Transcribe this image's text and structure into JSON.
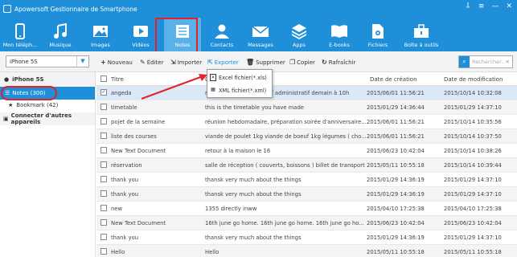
{
  "app": {
    "title": "Apowersoft Gestionnaire de Smartphone",
    "win_buttons": [
      "⇩",
      "≡",
      "—",
      "✕"
    ]
  },
  "toolbar": [
    {
      "label": "Mon téléph...",
      "icon": "phone-icon"
    },
    {
      "label": "Musique",
      "icon": "music-icon"
    },
    {
      "label": "Images",
      "icon": "image-icon"
    },
    {
      "label": "Vidéos",
      "icon": "video-icon"
    },
    {
      "label": "Notes",
      "icon": "notes-icon",
      "selected": true
    },
    {
      "label": "Contacts",
      "icon": "contacts-icon"
    },
    {
      "label": "Messages",
      "icon": "messages-icon"
    },
    {
      "label": "Apps",
      "icon": "apps-icon"
    },
    {
      "label": "E-books",
      "icon": "ebooks-icon"
    },
    {
      "label": "Fichiers",
      "icon": "files-icon"
    },
    {
      "label": "Boîte à outils",
      "icon": "toolbox-icon"
    }
  ],
  "device_select": "iPhone 5S",
  "ops": {
    "new": "Nouveau",
    "edit": "Éditer",
    "import": "Importer",
    "export": "Exporter",
    "delete": "Supprimer",
    "copy": "Copier",
    "refresh": "Rafraîchir"
  },
  "search": {
    "placeholder": "Rechercher..."
  },
  "sidebar": {
    "device": "iPhone 5S",
    "notes": "Notes (300)",
    "bookmark": "Bookmark (42)",
    "connect": "Connecter d'autres appareils"
  },
  "export_menu": {
    "excel": "Excel fichier(*.xls)",
    "xml": "XML fichier(*.xml)"
  },
  "table": {
    "headers": {
      "title": "Titre",
      "content": "C",
      "created": "Date de création",
      "modified": "Date de modification"
    },
    "rows": [
      {
        "title": "angeda",
        "content": "rendez-vous avec le chef administratif demain à 10h",
        "created": "2015/06/01 11:56:21",
        "modified": "2015/10/14 10:32:08",
        "checked": true
      },
      {
        "title": "timetable",
        "content": "this is the timetable you have made",
        "created": "2015/01/29 14:36:44",
        "modified": "2015/01/29 14:37:10"
      },
      {
        "title": "pojet de la semaine",
        "content": "réunion hebdomadaire, préparation soirée d'anniversaire...",
        "created": "2015/06/01 11:56:21",
        "modified": "2015/10/14 10:35:56"
      },
      {
        "title": "liste des courses",
        "content": "viande de poulet 1kg viande de boeuf 1kg légumes ( cho...",
        "created": "2015/06/01 11:56:21",
        "modified": "2015/10/14 10:37:50"
      },
      {
        "title": "New Text Document",
        "content": "retour à la maison le 16",
        "created": "2015/06/23 10:42:04",
        "modified": "2015/10/14 10:38:26"
      },
      {
        "title": "réservation",
        "content": "salle de réception ( couverts, boissons ) billet de transport",
        "created": "2015/05/11 10:55:18",
        "modified": "2015/10/14 10:39:44"
      },
      {
        "title": "thank you",
        "content": "thansk very much about the things",
        "created": "2015/01/29 14:36:19",
        "modified": "2015/01/29 14:37:10"
      },
      {
        "title": "thank you",
        "content": "thansk very much about the things",
        "created": "2015/01/29 14:36:19",
        "modified": "2015/01/29 14:37:10"
      },
      {
        "title": "new",
        "content": "1355 directly inww",
        "created": "2015/04/10 17:25:38",
        "modified": "2015/04/10 17:25:38"
      },
      {
        "title": "New Text Document",
        "content": "16th june go home. 16th june go home. 16th june go ho...",
        "created": "2015/06/23 10:42:04",
        "modified": "2015/06/23 10:42:04"
      },
      {
        "title": "thank you",
        "content": "thansk very much about the things",
        "created": "2015/01/29 14:36:19",
        "modified": "2015/01/29 14:37:10"
      },
      {
        "title": "Hello",
        "content": "Hello",
        "created": "2015/05/11 10:55:18",
        "modified": "2015/05/11 10:55:18"
      }
    ]
  },
  "colors": {
    "accent": "#1e8fd8",
    "highlight": "#e4202a"
  }
}
